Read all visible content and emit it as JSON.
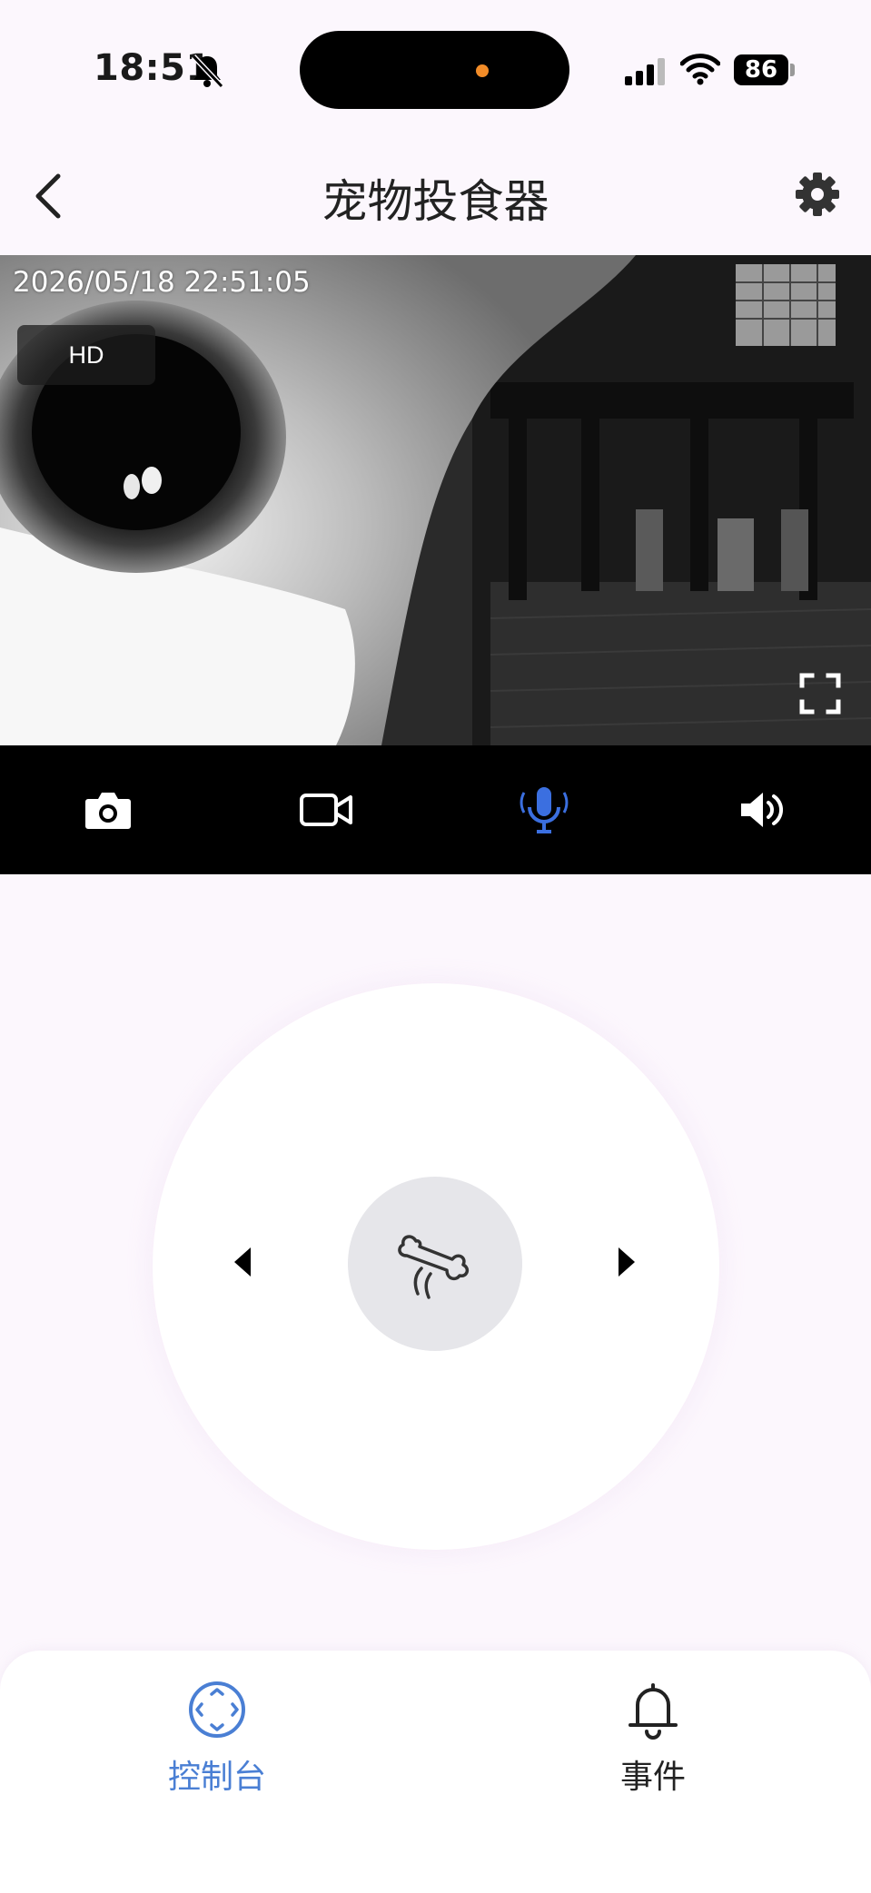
{
  "status_bar": {
    "time": "18:51",
    "silent_icon": "bell-slash-icon",
    "signal_icon": "cellular-signal-icon",
    "wifi_icon": "wifi-icon",
    "battery_level": "86"
  },
  "nav": {
    "title": "宠物投食器",
    "back_icon": "chevron-left-icon",
    "settings_icon": "gear-icon"
  },
  "camera": {
    "timestamp": "2026/05/18 22:51:05",
    "quality_label": "HD",
    "fullscreen_icon": "fullscreen-icon",
    "feed_description_hidden": false
  },
  "camera_toolbar": {
    "items": [
      {
        "icon": "camera-icon"
      },
      {
        "icon": "video-camera-icon"
      },
      {
        "icon": "microphone-icon",
        "active": true,
        "color": "#3b6fe0"
      },
      {
        "icon": "speaker-icon"
      }
    ]
  },
  "control_pad": {
    "left_icon": "caret-left-icon",
    "right_icon": "caret-right-icon",
    "center_icon": "bone-feed-icon"
  },
  "tabs": [
    {
      "label": "控制台",
      "icon": "joystick-icon",
      "active": true,
      "color": "#4a7fd4"
    },
    {
      "label": "事件",
      "icon": "bell-icon",
      "active": false
    }
  ],
  "colors": {
    "background": "#fcf7fd",
    "accent": "#4a7fd4",
    "island_indicator": "#f28c28"
  }
}
